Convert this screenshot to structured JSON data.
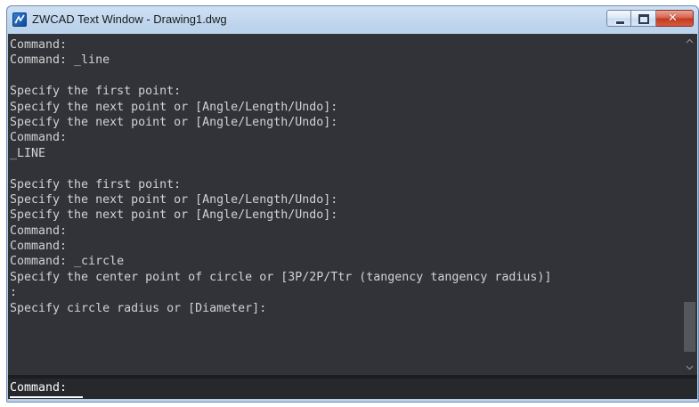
{
  "window": {
    "title": "ZWCAD Text Window - Drawing1.dwg",
    "icon": "zwcad-app-icon"
  },
  "caption_buttons": {
    "minimize": "minimize-icon",
    "maximize": "maximize-icon",
    "close": "close-icon",
    "close_glyph": "✕"
  },
  "history": {
    "lines": [
      "Command:",
      "Command: _line",
      "",
      "Specify the first point:",
      "Specify the next point or [Angle/Length/Undo]:",
      "Specify the next point or [Angle/Length/Undo]:",
      "Command:",
      "_LINE",
      "",
      "Specify the first point:",
      "Specify the next point or [Angle/Length/Undo]:",
      "Specify the next point or [Angle/Length/Undo]:",
      "Command:",
      "Command:",
      "Command: _circle",
      "Specify the center point of circle or [3P/2P/Ttr (tangency tangency radius)]",
      ":",
      "Specify circle radius or [Diameter]:"
    ]
  },
  "scrollbar": {
    "up_arrow": "^",
    "down_arrow": "v",
    "position": 1.0
  },
  "command_line": {
    "prompt": "Command:",
    "value": ""
  },
  "colors": {
    "console_bg": "#313338",
    "text": "#d2d2d2",
    "prompt_text": "#ffffff"
  }
}
